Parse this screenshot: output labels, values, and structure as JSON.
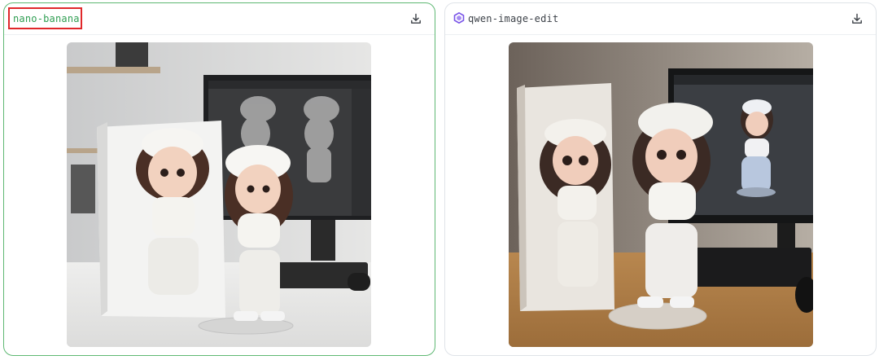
{
  "panels": [
    {
      "model_name": "nano-banana",
      "selected": true,
      "download_icon": "download-icon",
      "image_description_icon": "generated-image"
    },
    {
      "model_name": "qwen-image-edit",
      "selected": false,
      "model_icon": "qwen-logo-icon",
      "download_icon": "download-icon"
    }
  ],
  "colors": {
    "selected_border": "#5fb873",
    "selected_title": "#2f9e52",
    "highlight_box": "#e0282b",
    "qwen_logo": "#7a55e8"
  }
}
